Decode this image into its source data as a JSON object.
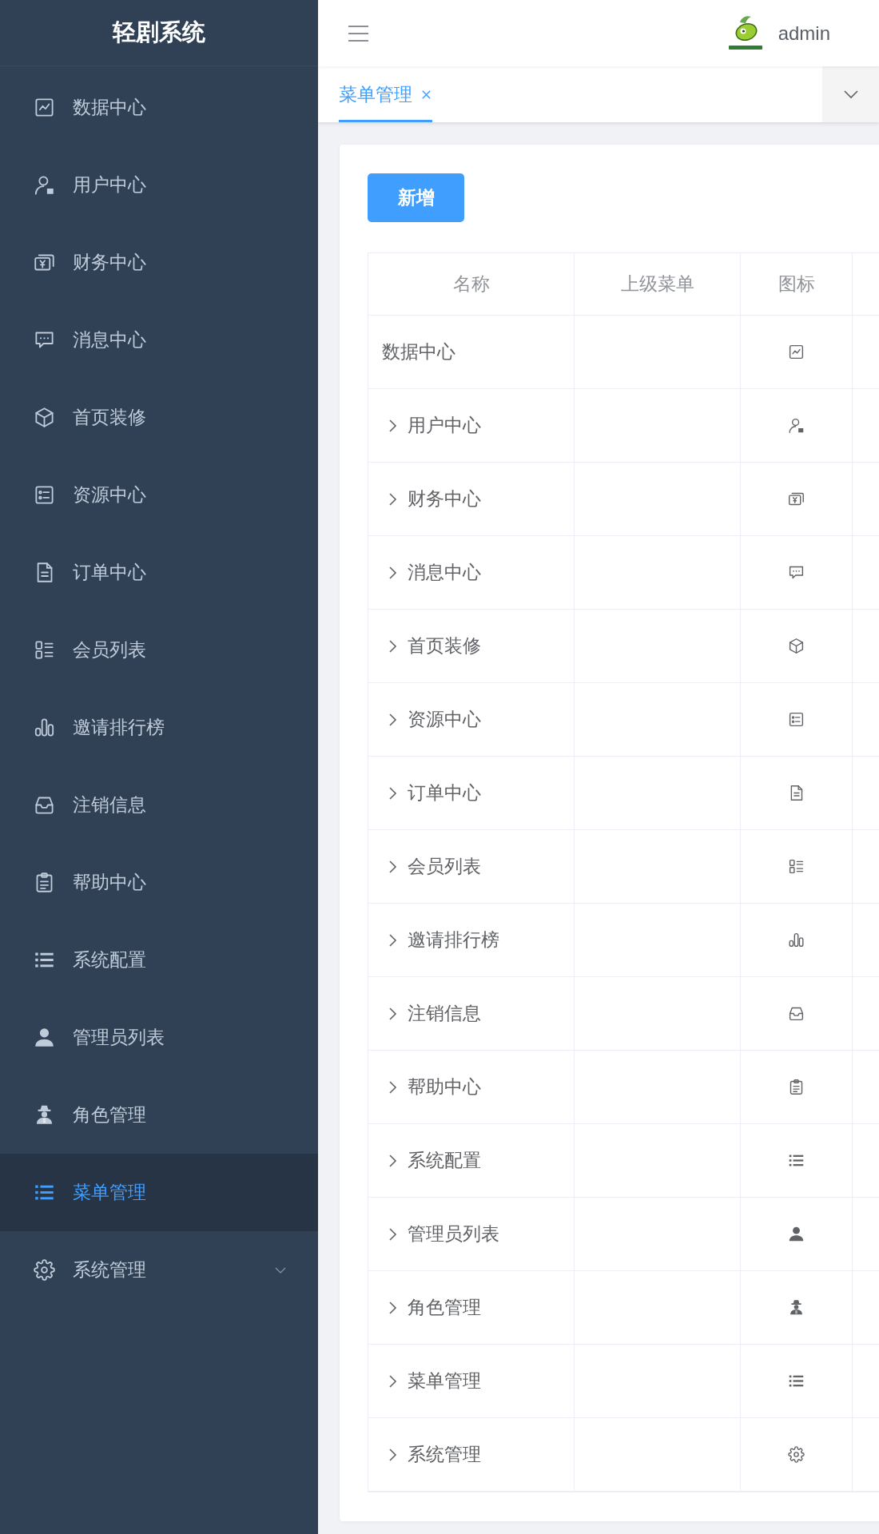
{
  "sidebar": {
    "title": "轻剧系统",
    "items": [
      {
        "label": "数据中心",
        "selected": false
      },
      {
        "label": "用户中心",
        "selected": false
      },
      {
        "label": "财务中心",
        "selected": false
      },
      {
        "label": "消息中心",
        "selected": false
      },
      {
        "label": "首页装修",
        "selected": false
      },
      {
        "label": "资源中心",
        "selected": false
      },
      {
        "label": "订单中心",
        "selected": false
      },
      {
        "label": "会员列表",
        "selected": false
      },
      {
        "label": "邀请排行榜",
        "selected": false
      },
      {
        "label": "注销信息",
        "selected": false
      },
      {
        "label": "帮助中心",
        "selected": false
      },
      {
        "label": "系统配置",
        "selected": false
      },
      {
        "label": "管理员列表",
        "selected": false
      },
      {
        "label": "角色管理",
        "selected": false
      },
      {
        "label": "菜单管理",
        "selected": true
      },
      {
        "label": "系统管理",
        "selected": false,
        "expanded": false
      }
    ]
  },
  "header": {
    "user": "admin"
  },
  "tabs": [
    {
      "label": "菜单管理",
      "selected": true
    }
  ],
  "toolbar": {
    "add_button": "新增"
  },
  "table": {
    "columns": [
      "名称",
      "上级菜单",
      "图标"
    ],
    "rows": [
      {
        "name": "数据中心"
      },
      {
        "name": "用户中心",
        "expanded": false
      },
      {
        "name": "财务中心",
        "expanded": false
      },
      {
        "name": "消息中心",
        "expanded": false
      },
      {
        "name": "首页装修",
        "expanded": false
      },
      {
        "name": "资源中心",
        "expanded": false
      },
      {
        "name": "订单中心",
        "expanded": false
      },
      {
        "name": "会员列表",
        "expanded": false
      },
      {
        "name": "邀请排行榜",
        "expanded": false
      },
      {
        "name": "注销信息",
        "expanded": false
      },
      {
        "name": "帮助中心",
        "expanded": false
      },
      {
        "name": "系统配置",
        "expanded": false
      },
      {
        "name": "管理员列表",
        "expanded": false
      },
      {
        "name": "角色管理",
        "expanded": false
      },
      {
        "name": "菜单管理",
        "expanded": false
      },
      {
        "name": "系统管理",
        "expanded": false
      }
    ]
  }
}
